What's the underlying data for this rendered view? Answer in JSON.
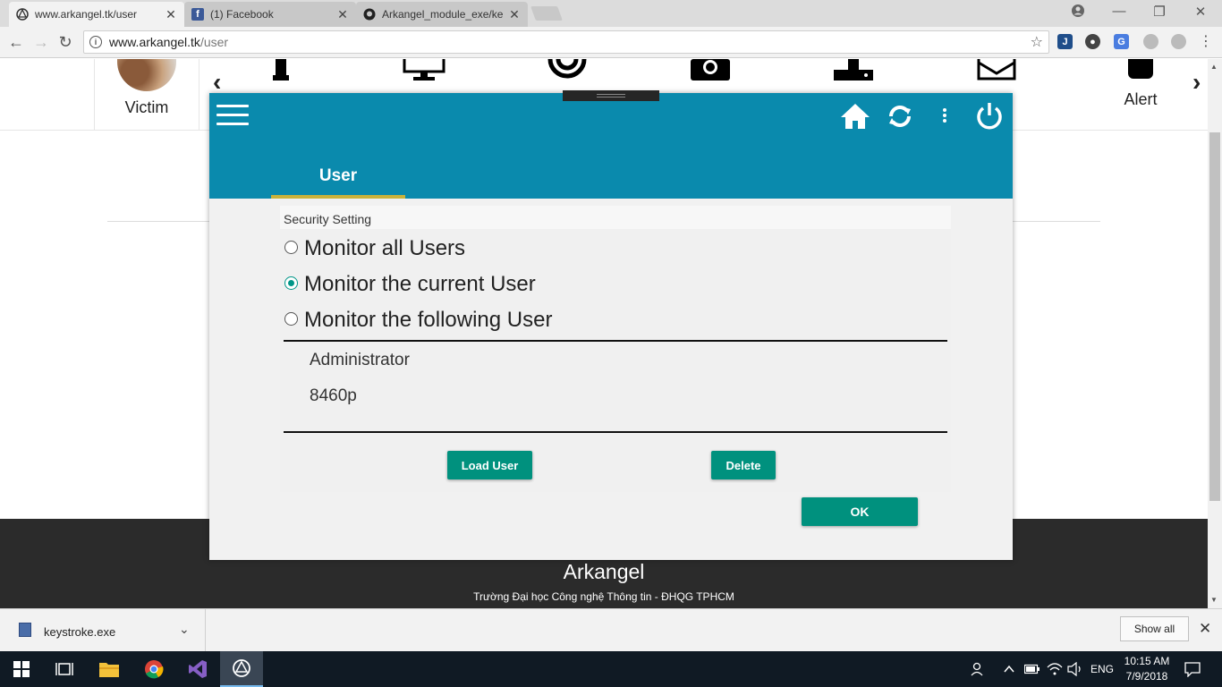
{
  "browser": {
    "tabs": [
      {
        "title": "www.arkangel.tk/user",
        "icon": "arkangel-icon",
        "active": true
      },
      {
        "title": "(1) Facebook",
        "icon": "facebook-icon",
        "active": false
      },
      {
        "title": "Arkangel_module_exe/ke",
        "icon": "github-icon",
        "active": false
      }
    ],
    "url_host": "www.arkangel.tk",
    "url_path": "/user"
  },
  "page": {
    "victim_label": "Victim",
    "alert_label": "Alert",
    "footer_brand": "Arkangel",
    "footer_sub": "Trường Đại học Công nghệ Thông tin - ĐHQG TPHCM"
  },
  "modal": {
    "tab_label": "User",
    "section_title": "Security Setting",
    "options": [
      {
        "label": "Monitor all Users",
        "selected": false
      },
      {
        "label": "Monitor the current User",
        "selected": true
      },
      {
        "label": "Monitor the following User",
        "selected": false
      }
    ],
    "users": [
      "Administrator",
      "8460p"
    ],
    "load_user_label": "Load User",
    "delete_label": "Delete",
    "ok_label": "OK",
    "accent_color": "#0a8aad",
    "button_color": "#00917e"
  },
  "download_bar": {
    "file_name": "keystroke.exe",
    "show_all_label": "Show all"
  },
  "taskbar": {
    "language": "ENG",
    "time": "10:15 AM",
    "date": "7/9/2018"
  }
}
